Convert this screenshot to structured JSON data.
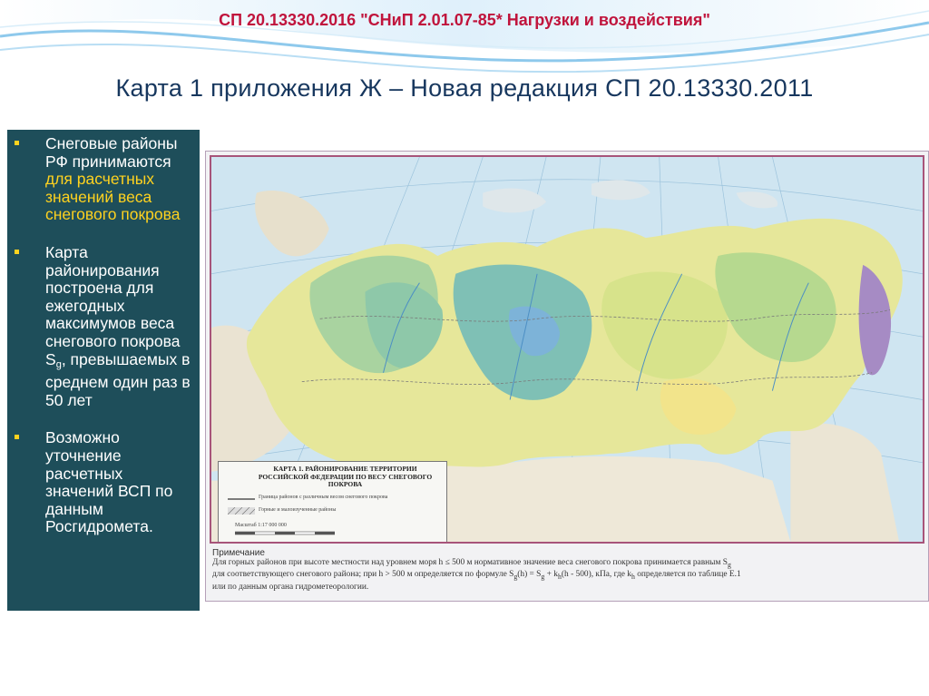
{
  "header": {
    "title": "СП 20.13330.2016 \"СНиП 2.01.07-85* Нагрузки и воздействия\""
  },
  "slide": {
    "title": "Карта 1 приложения Ж – Новая редакция СП 20.13330.2011"
  },
  "bullets": [
    {
      "text_before": "Снеговые районы РФ принимаются ",
      "highlight": "для расчетных значений веса снегового покрова",
      "text_after": ""
    },
    {
      "text_before": "Карта районирования построена для ежегодных максимумов веса снегового покрова S",
      "subscript": "g",
      "text_after": ", превышаемых в среднем один раз в 50 лет"
    },
    {
      "text": "Возможно уточнение расчетных значений ВСП по данным Росгидромета."
    }
  ],
  "map": {
    "legend": {
      "title": "КАРТА 1. РАЙОНИРОВАНИЕ ТЕРРИТОРИИ РОССИЙСКОЙ ФЕДЕРАЦИИ ПО ВЕСУ СНЕГОВОГО ПОКРОВА",
      "row1": "Граница районов с различным весом снегового покрова",
      "row2": "Горные и малоизученные районы",
      "scale_label": "Масштаб 1:17 000 000"
    },
    "note": {
      "title": "Примечание",
      "line1": "Для горных районов при высоте местности над уровнем моря h ≤ 500 м нормативное значение веса снегового покрова принимается равным S",
      "line1_sub": "g",
      "line2_a": "для соответствующего снегового района; при h > 500 м  определяется по формуле S",
      "line2_b": "(h) = S",
      "line2_c": " + k",
      "line2_d": "(h - 500), кПа, где k",
      "line2_e": " определяется по таблице Е.1",
      "sub_g": "g",
      "sub_h": "h",
      "line3": "или по данным органа гидрометеорологии."
    }
  },
  "colors": {
    "header_red": "#c0143c",
    "title_navy": "#17375e",
    "panel_teal": "#1e4e5a",
    "highlight_yellow": "#ffd21f",
    "map_border": "#a7547a"
  }
}
